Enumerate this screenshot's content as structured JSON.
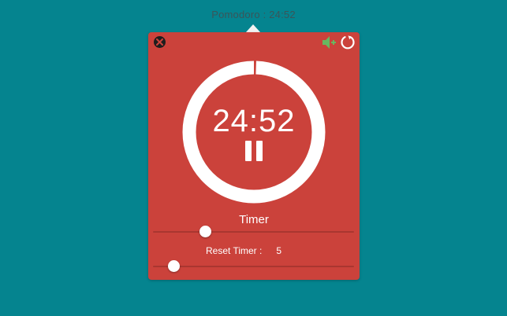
{
  "menubar": {
    "title": "Pomodoro : 24:52"
  },
  "timer": {
    "display": "24:52",
    "remaining_fraction": 0.9947
  },
  "controls": {
    "timer_label": "Timer",
    "timer_slider_fraction": 0.26,
    "reset_label": "Reset Timer :",
    "reset_value": "5",
    "reset_slider_fraction": 0.1
  },
  "icons": {
    "close": "close-icon",
    "sound": "speaker-icon",
    "refresh": "refresh-icon",
    "pause": "pause-icon"
  },
  "colors": {
    "background": "#05848f",
    "panel": "#cb423b",
    "ring": "#ffffff",
    "sound_icon": "#68b860"
  }
}
